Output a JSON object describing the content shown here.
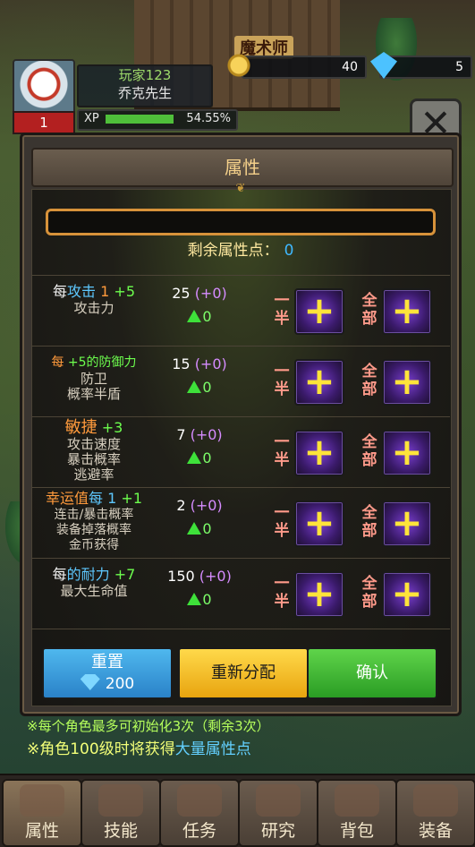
{
  "hud": {
    "player_tag": "玩家123",
    "player_name": "乔克先生",
    "level": "1",
    "xp_label": "XP",
    "xp_percent": "54.55%",
    "xp_fraction": 0.5455,
    "coins": "40",
    "gems": "5",
    "shop_name": "魔术师"
  },
  "panel": {
    "title": "属性",
    "remaining_label": "剩余属性点：",
    "remaining_value": "0",
    "half_label": "一半",
    "all_label": "全部",
    "plus_symbol": "+",
    "close_symbol": "✕"
  },
  "stats": [
    {
      "head_a": "每",
      "head_b": "攻击",
      "head_c": "1",
      "head_d": "+5",
      "desc": [
        "攻击力"
      ],
      "value": "25",
      "bonus": "(+0)",
      "up": "0"
    },
    {
      "head_a": "每",
      "head_b": "+5的防御力",
      "head_c": "",
      "head_d": "",
      "desc": [
        "防卫",
        "概率半盾"
      ],
      "value": "15",
      "bonus": "(+0)",
      "up": "0"
    },
    {
      "head_a": "敏捷",
      "head_b": "",
      "head_c": "",
      "head_d": "+3",
      "desc": [
        "攻击速度",
        "暴击概率",
        "逃避率"
      ],
      "value": "7",
      "bonus": "(+0)",
      "up": "0"
    },
    {
      "head_a": "幸运值",
      "head_b": "每",
      "head_c": "1",
      "head_d": "+1",
      "desc": [
        "连击/暴击概率",
        "装备掉落概率",
        "金币获得"
      ],
      "value": "2",
      "bonus": "(+0)",
      "up": "0"
    },
    {
      "head_a": "每",
      "head_b": "的耐力",
      "head_c": "",
      "head_d": "+7",
      "desc": [
        "最大生命值"
      ],
      "value": "150",
      "bonus": "(+0)",
      "up": "0"
    }
  ],
  "buttons": {
    "reset_label": "重置",
    "reset_cost": "200",
    "redistribute_label": "重新分配",
    "confirm_label": "确认"
  },
  "notes": {
    "note1": "※每个角色最多可初始化3次（剩余3次）",
    "note2_a": "※角色100级时将获得",
    "note2_b": "大量属性点"
  },
  "nav": [
    {
      "label": "属性",
      "icon": "arm-muscle-icon"
    },
    {
      "label": "技能",
      "icon": "crossed-swords-icon"
    },
    {
      "label": "任务",
      "icon": "scroll-icon"
    },
    {
      "label": "研究",
      "icon": "spellbook-icon"
    },
    {
      "label": "背包",
      "icon": "backpack-icon"
    },
    {
      "label": "装备",
      "icon": "treasure-chest-icon"
    }
  ]
}
